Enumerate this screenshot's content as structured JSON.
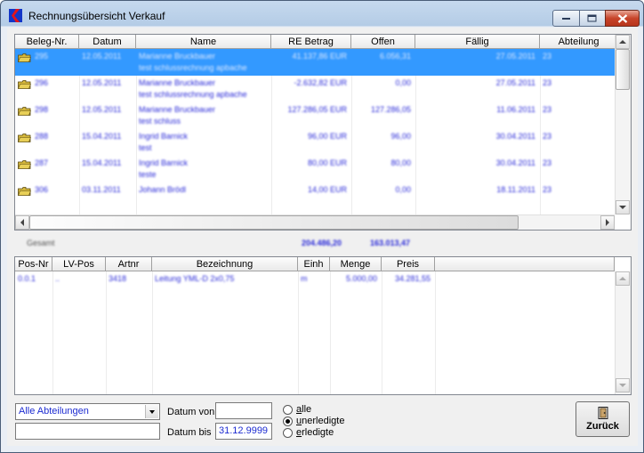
{
  "window": {
    "title": "Rechnungsübersicht Verkauf"
  },
  "invoices": {
    "columns": [
      "Beleg-Nr.",
      "Datum",
      "Name",
      "RE Betrag",
      "Offen",
      "Fällig",
      "Abteilung"
    ],
    "rows": [
      {
        "beleg": "295",
        "datum": "12.05.2011",
        "name": "Marianne Bruckbauer",
        "name2": "test schlussrechnung apbache",
        "betrag": "41.137,86 EUR",
        "offen": "6.056,31",
        "faellig": "27.05.2011",
        "abteilung": "23",
        "selected": true
      },
      {
        "beleg": "296",
        "datum": "12.05.2011",
        "name": "Marianne Bruckbauer",
        "name2": "test schlussrechnung apbache",
        "betrag": "-2.632,82 EUR",
        "offen": "0,00",
        "faellig": "27.05.2011",
        "abteilung": "23",
        "selected": false
      },
      {
        "beleg": "298",
        "datum": "12.05.2011",
        "name": "Marianne Bruckbauer",
        "name2": "test schluss",
        "betrag": "127.286,05 EUR",
        "offen": "127.286,05",
        "faellig": "11.06.2011",
        "abteilung": "23",
        "selected": false
      },
      {
        "beleg": "288",
        "datum": "15.04.2011",
        "name": "Ingrid Barnick",
        "name2": "test",
        "betrag": "96,00 EUR",
        "offen": "96,00",
        "faellig": "30.04.2011",
        "abteilung": "23",
        "selected": false
      },
      {
        "beleg": "287",
        "datum": "15.04.2011",
        "name": "Ingrid Barnick",
        "name2": "teste",
        "betrag": "80,00 EUR",
        "offen": "80,00",
        "faellig": "30.04.2011",
        "abteilung": "23",
        "selected": false
      },
      {
        "beleg": "306",
        "datum": "03.11.2011",
        "name": "Johann Brödl",
        "name2": "",
        "betrag": "14,00 EUR",
        "offen": "0,00",
        "faellig": "18.11.2011",
        "abteilung": "23",
        "selected": false
      }
    ]
  },
  "totals": {
    "label": "Gesamt",
    "betrag": "204.486,20",
    "offen": "163.013,47"
  },
  "positions": {
    "columns": [
      "Pos-Nr",
      "LV-Pos",
      "Artnr",
      "Bezeichnung",
      "Einh",
      "Menge",
      "Preis"
    ],
    "rows": [
      {
        "pos": "0.0.1",
        "lvpos": "..",
        "artnr": "3418",
        "bezeichnung": "Leitung YML-D 2x0,75",
        "einh": "m",
        "menge": "5.000,00",
        "preis": "34.281,55"
      }
    ]
  },
  "filters": {
    "department_select": "Alle Abteilungen",
    "free_text": "",
    "datum_von_label": "Datum von",
    "datum_von": "",
    "datum_bis_label": "Datum bis",
    "datum_bis": "31.12.9999",
    "radio_all": "alle",
    "radio_open": "unerledigte",
    "radio_done": "erledigte",
    "selected_radio": "unerledigte"
  },
  "buttons": {
    "back": "Zurück"
  },
  "colors": {
    "selection": "#3399ff",
    "cell_text": "#2a2ad8",
    "field_text": "#1c2bd1"
  }
}
